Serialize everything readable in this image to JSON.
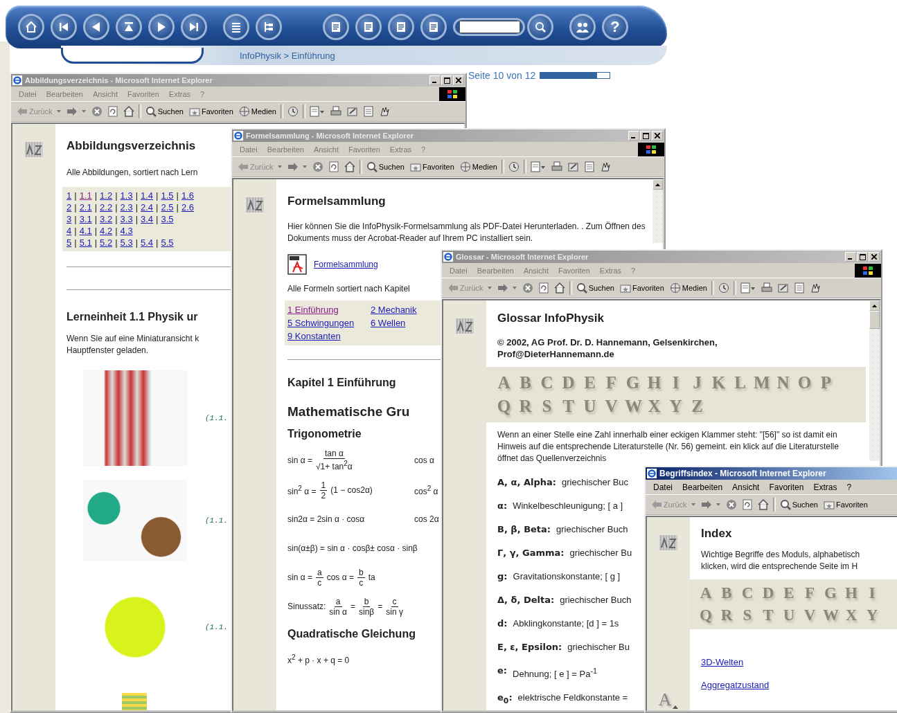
{
  "banner": {
    "buttons": [
      {
        "kind": "home"
      },
      {
        "kind": "first"
      },
      {
        "kind": "prev"
      },
      {
        "kind": "up"
      },
      {
        "kind": "next"
      },
      {
        "kind": "last"
      },
      {
        "kind": "list"
      },
      {
        "kind": "tree"
      },
      {
        "kind": "page"
      },
      {
        "kind": "pages"
      },
      {
        "kind": "calc"
      },
      {
        "kind": "copy"
      },
      {
        "kind": "search_field"
      },
      {
        "kind": "search"
      },
      {
        "kind": "people"
      },
      {
        "kind": "help",
        "glyph": "?"
      }
    ],
    "breadcrumb": "InfoPhysik > Einführung"
  },
  "page_indicator": {
    "text": "Seite 10 von 12",
    "level": 0.82
  },
  "windows": [
    {
      "kind": "figures",
      "title": "Abbildungsverzeichnis - Microsoft Internet Explorer",
      "active": false,
      "menu": [
        "Datei",
        "Bearbeiten",
        "Ansicht",
        "Favoriten",
        "Extras",
        "?"
      ],
      "toolbar": [
        {
          "kind": "back",
          "label": "Zurück"
        },
        {
          "kind": "forward"
        },
        {
          "kind": "stop"
        },
        {
          "kind": "refresh"
        },
        {
          "kind": "home"
        },
        {
          "kind": "search",
          "label": "Suchen"
        },
        {
          "kind": "favorites",
          "label": "Favoriten"
        },
        {
          "kind": "media",
          "label": "Medien"
        },
        {
          "kind": "history"
        },
        {
          "kind": "mail"
        },
        {
          "kind": "print"
        },
        {
          "kind": "edit"
        },
        {
          "kind": "discuss"
        },
        {
          "kind": "messenger"
        }
      ],
      "heading": "Abbildungsverzeichnis",
      "intro": "Alle Abbildungen, sortiert nach Lern",
      "link_grid": {
        "separator": "|",
        "rows": [
          [
            {
              "text": "1",
              "visited": false
            },
            {
              "text": "1.1",
              "visited": true
            },
            {
              "text": "1.2",
              "visited": false
            },
            {
              "text": "1.3",
              "visited": false
            },
            {
              "text": "1.4",
              "visited": false
            },
            {
              "text": "1.5",
              "visited": false
            },
            {
              "text": "1.6",
              "visited": false
            }
          ],
          [
            {
              "text": "2",
              "visited": false
            },
            {
              "text": "2.1",
              "visited": false
            },
            {
              "text": "2.2",
              "visited": false
            },
            {
              "text": "2.3",
              "visited": false
            },
            {
              "text": "2.4",
              "visited": false
            },
            {
              "text": "2.5",
              "visited": false
            },
            {
              "text": "2.6",
              "visited": false
            }
          ],
          [
            {
              "text": "3",
              "visited": false
            },
            {
              "text": "3.1",
              "visited": false
            },
            {
              "text": "3.2",
              "visited": false
            },
            {
              "text": "3.3",
              "visited": false
            },
            {
              "text": "3.4",
              "visited": false
            },
            {
              "text": "3.5",
              "visited": false
            }
          ],
          [
            {
              "text": "4",
              "visited": false
            },
            {
              "text": "4.1",
              "visited": false
            },
            {
              "text": "4.2",
              "visited": false
            },
            {
              "text": "4.3",
              "visited": false
            }
          ],
          [
            {
              "text": "5",
              "visited": false
            },
            {
              "text": "5.1",
              "visited": false
            },
            {
              "text": "5.2",
              "visited": false
            },
            {
              "text": "5.3",
              "visited": false
            },
            {
              "text": "5.4",
              "visited": false
            },
            {
              "text": "5.5",
              "visited": false
            }
          ]
        ]
      },
      "section_heading": "Lerneinheit 1.1 Physik ur",
      "text_lines": [
        "Wenn Sie auf eine Miniaturansicht k",
        "Hauptfenster geladen."
      ],
      "figures": [
        {
          "kind": "coil",
          "caption": "(1.1."
        },
        {
          "kind": "globe",
          "caption": "(1.1."
        },
        {
          "kind": "tree",
          "caption": "(1.1."
        },
        {
          "kind": "table"
        }
      ]
    },
    {
      "kind": "formulas",
      "title": "Formelsammlung - Microsoft Internet Explorer",
      "active": false,
      "menu": [
        "Datei",
        "Bearbeiten",
        "Ansicht",
        "Favoriten",
        "Extras",
        "?"
      ],
      "toolbar": [
        {
          "kind": "back",
          "label": "Zurück"
        },
        {
          "kind": "forward"
        },
        {
          "kind": "stop"
        },
        {
          "kind": "refresh"
        },
        {
          "kind": "home"
        },
        {
          "kind": "search",
          "label": "Suchen"
        },
        {
          "kind": "favorites",
          "label": "Favoriten"
        },
        {
          "kind": "media",
          "label": "Medien"
        },
        {
          "kind": "history"
        },
        {
          "kind": "mail"
        },
        {
          "kind": "print"
        },
        {
          "kind": "edit"
        },
        {
          "kind": "discuss"
        },
        {
          "kind": "messenger"
        }
      ],
      "heading": "Formelsammlung",
      "paragraph": "Hier können Sie die InfoPhysik-Formelsammlung als PDF-Datei Herunterladen. . Zum Öffnen des Dokuments muss der Acrobat-Reader auf Ihrem PC installiert sein.",
      "pdf_link": "Formelsammlung",
      "intro": "Alle Formeln sortiert nach Kapitel",
      "chapters": [
        {
          "text": "1 Einführung",
          "visited": true
        },
        {
          "text": "2 Mechanik",
          "visited": false
        },
        {
          "text": "5 Schwingungen",
          "visited": false
        },
        {
          "text": "6 Wellen",
          "visited": false
        },
        {
          "text": "9 Konstanten",
          "visited": false
        }
      ],
      "chapter_heading": "Kapitel 1 Einführung",
      "section_heading": "Mathematische Gru",
      "subheading": "Trigonometrie",
      "formulas": [
        {
          "left": [
            {
              "t": "sin α ="
            },
            {
              "num": "tan α",
              "den": "√1+ tan$^{2}$α"
            }
          ],
          "right": "cos α"
        },
        {
          "left": [
            {
              "t": "sin$^{2}$ α ="
            },
            {
              "num": "1",
              "den": "2"
            },
            {
              "t": "(1 − cos2α)"
            }
          ],
          "right": "cos$^{2}$ α"
        },
        {
          "left": [
            {
              "t": "sin2α = 2sin α · cosα"
            }
          ],
          "right": "cos 2α"
        },
        {
          "left": [
            {
              "t": "sin(α±β) = sin α · cosβ± cosα · sinβ"
            }
          ]
        },
        {
          "left": [
            {
              "t": "sin  α ="
            },
            {
              "num": "a",
              "den": "c"
            },
            {
              "t": "cos  α ="
            },
            {
              "num": "b",
              "den": "c"
            },
            {
              "t": "ta"
            }
          ]
        },
        {
          "left": [
            {
              "t": "Sinussatz:"
            },
            {
              "num": "a",
              "den": "sin α"
            },
            {
              "t": "="
            },
            {
              "num": "b",
              "den": "sinβ"
            },
            {
              "t": "="
            },
            {
              "num": "c",
              "den": "sin γ"
            }
          ]
        }
      ],
      "subheading_2": "Quadratische Gleichung",
      "formulas_2": [
        {
          "left": [
            {
              "t": "x$^{2}$ + p · x + q = 0"
            }
          ]
        }
      ]
    },
    {
      "kind": "glossary",
      "title": "Glossar - Microsoft Internet Explorer",
      "active": false,
      "menu": [
        "Datei",
        "Bearbeiten",
        "Ansicht",
        "Favoriten",
        "Extras",
        "?"
      ],
      "toolbar": [
        {
          "kind": "back",
          "label": "Zurück"
        },
        {
          "kind": "forward"
        },
        {
          "kind": "stop"
        },
        {
          "kind": "refresh"
        },
        {
          "kind": "home"
        },
        {
          "kind": "search",
          "label": "Suchen"
        },
        {
          "kind": "favorites",
          "label": "Favoriten"
        },
        {
          "kind": "media",
          "label": "Medien"
        },
        {
          "kind": "history"
        },
        {
          "kind": "mail"
        },
        {
          "kind": "print"
        },
        {
          "kind": "edit"
        },
        {
          "kind": "discuss"
        },
        {
          "kind": "messenger"
        }
      ],
      "heading": "Glossar InfoPhysik",
      "copyright": "© 2002, AG Prof. Dr. D. Hannemann, Gelsenkirchen, Prof@DieterHannemann.de",
      "letters": [
        [
          "A",
          "B",
          "C",
          "D",
          "E",
          "F",
          "G",
          "H",
          "I",
          "J",
          "K",
          "L",
          "M",
          "N",
          "O",
          "P"
        ],
        [
          "Q",
          "R",
          "S",
          "T",
          "U",
          "V",
          "W",
          "X",
          "Y",
          "Z"
        ]
      ],
      "note": "Wenn an einer Stelle eine Zahl innerhalb einer eckigen Klammer steht: \"[56]\" so ist damit ein Hinweis auf die entsprechende Literaturstelle (Nr. 56) gemeint. ein klick auf die Literaturstelle öffnet das Quellenverzeichnis",
      "entries": [
        {
          "term": "Α, α, Alpha:",
          "desc": "griechischer Buc"
        },
        {
          "term": "α:",
          "desc": "Winkelbeschleunigung; [ a ]"
        },
        {
          "term": "Β, β, Beta:",
          "desc": "griechischer Buch"
        },
        {
          "term": "Γ, γ, Gamma:",
          "desc": "griechischer Bu"
        },
        {
          "term": "g:",
          "desc": "Gravitationskonstante; [ g ]"
        },
        {
          "term": "Δ, δ, Delta:",
          "desc": "griechischer Buch"
        },
        {
          "term": "d:",
          "desc": "Abklingkonstante; [d ] = 1s"
        },
        {
          "term": "Ε, ε, Epsilon:",
          "desc": "griechischer Bu"
        },
        {
          "term": "e:",
          "desc": "Dehnung; [ e ] = Pa$^{-1}$"
        },
        {
          "term": "e$_{0}$:",
          "desc": "elektrische Feldkonstante ="
        }
      ]
    },
    {
      "kind": "index",
      "title": "Begriffsindex - Microsoft Internet Explorer",
      "active": true,
      "menu": [
        "Datei",
        "Bearbeiten",
        "Ansicht",
        "Favoriten",
        "Extras",
        "?"
      ],
      "toolbar": [
        {
          "kind": "back",
          "label": "Zurück"
        },
        {
          "kind": "forward"
        },
        {
          "kind": "stop"
        },
        {
          "kind": "refresh"
        },
        {
          "kind": "home"
        },
        {
          "kind": "search",
          "label": "Suchen"
        },
        {
          "kind": "favorites",
          "label": "Favoriten"
        }
      ],
      "heading": "Index",
      "intro_lines": [
        "Wichtige Begriffe des Moduls, alphabetisch",
        "klicken, wird die entsprechende Seite im H"
      ],
      "letters": [
        [
          "A",
          "B",
          "C",
          "D",
          "E",
          "F",
          "G",
          "H",
          "I"
        ],
        [
          "Q",
          "R",
          "S",
          "T",
          "U",
          "V",
          "W",
          "X",
          "Y"
        ]
      ],
      "links": [
        "3D-Welten",
        "Aggregatzustand"
      ],
      "sidebar_letter": "A"
    }
  ]
}
